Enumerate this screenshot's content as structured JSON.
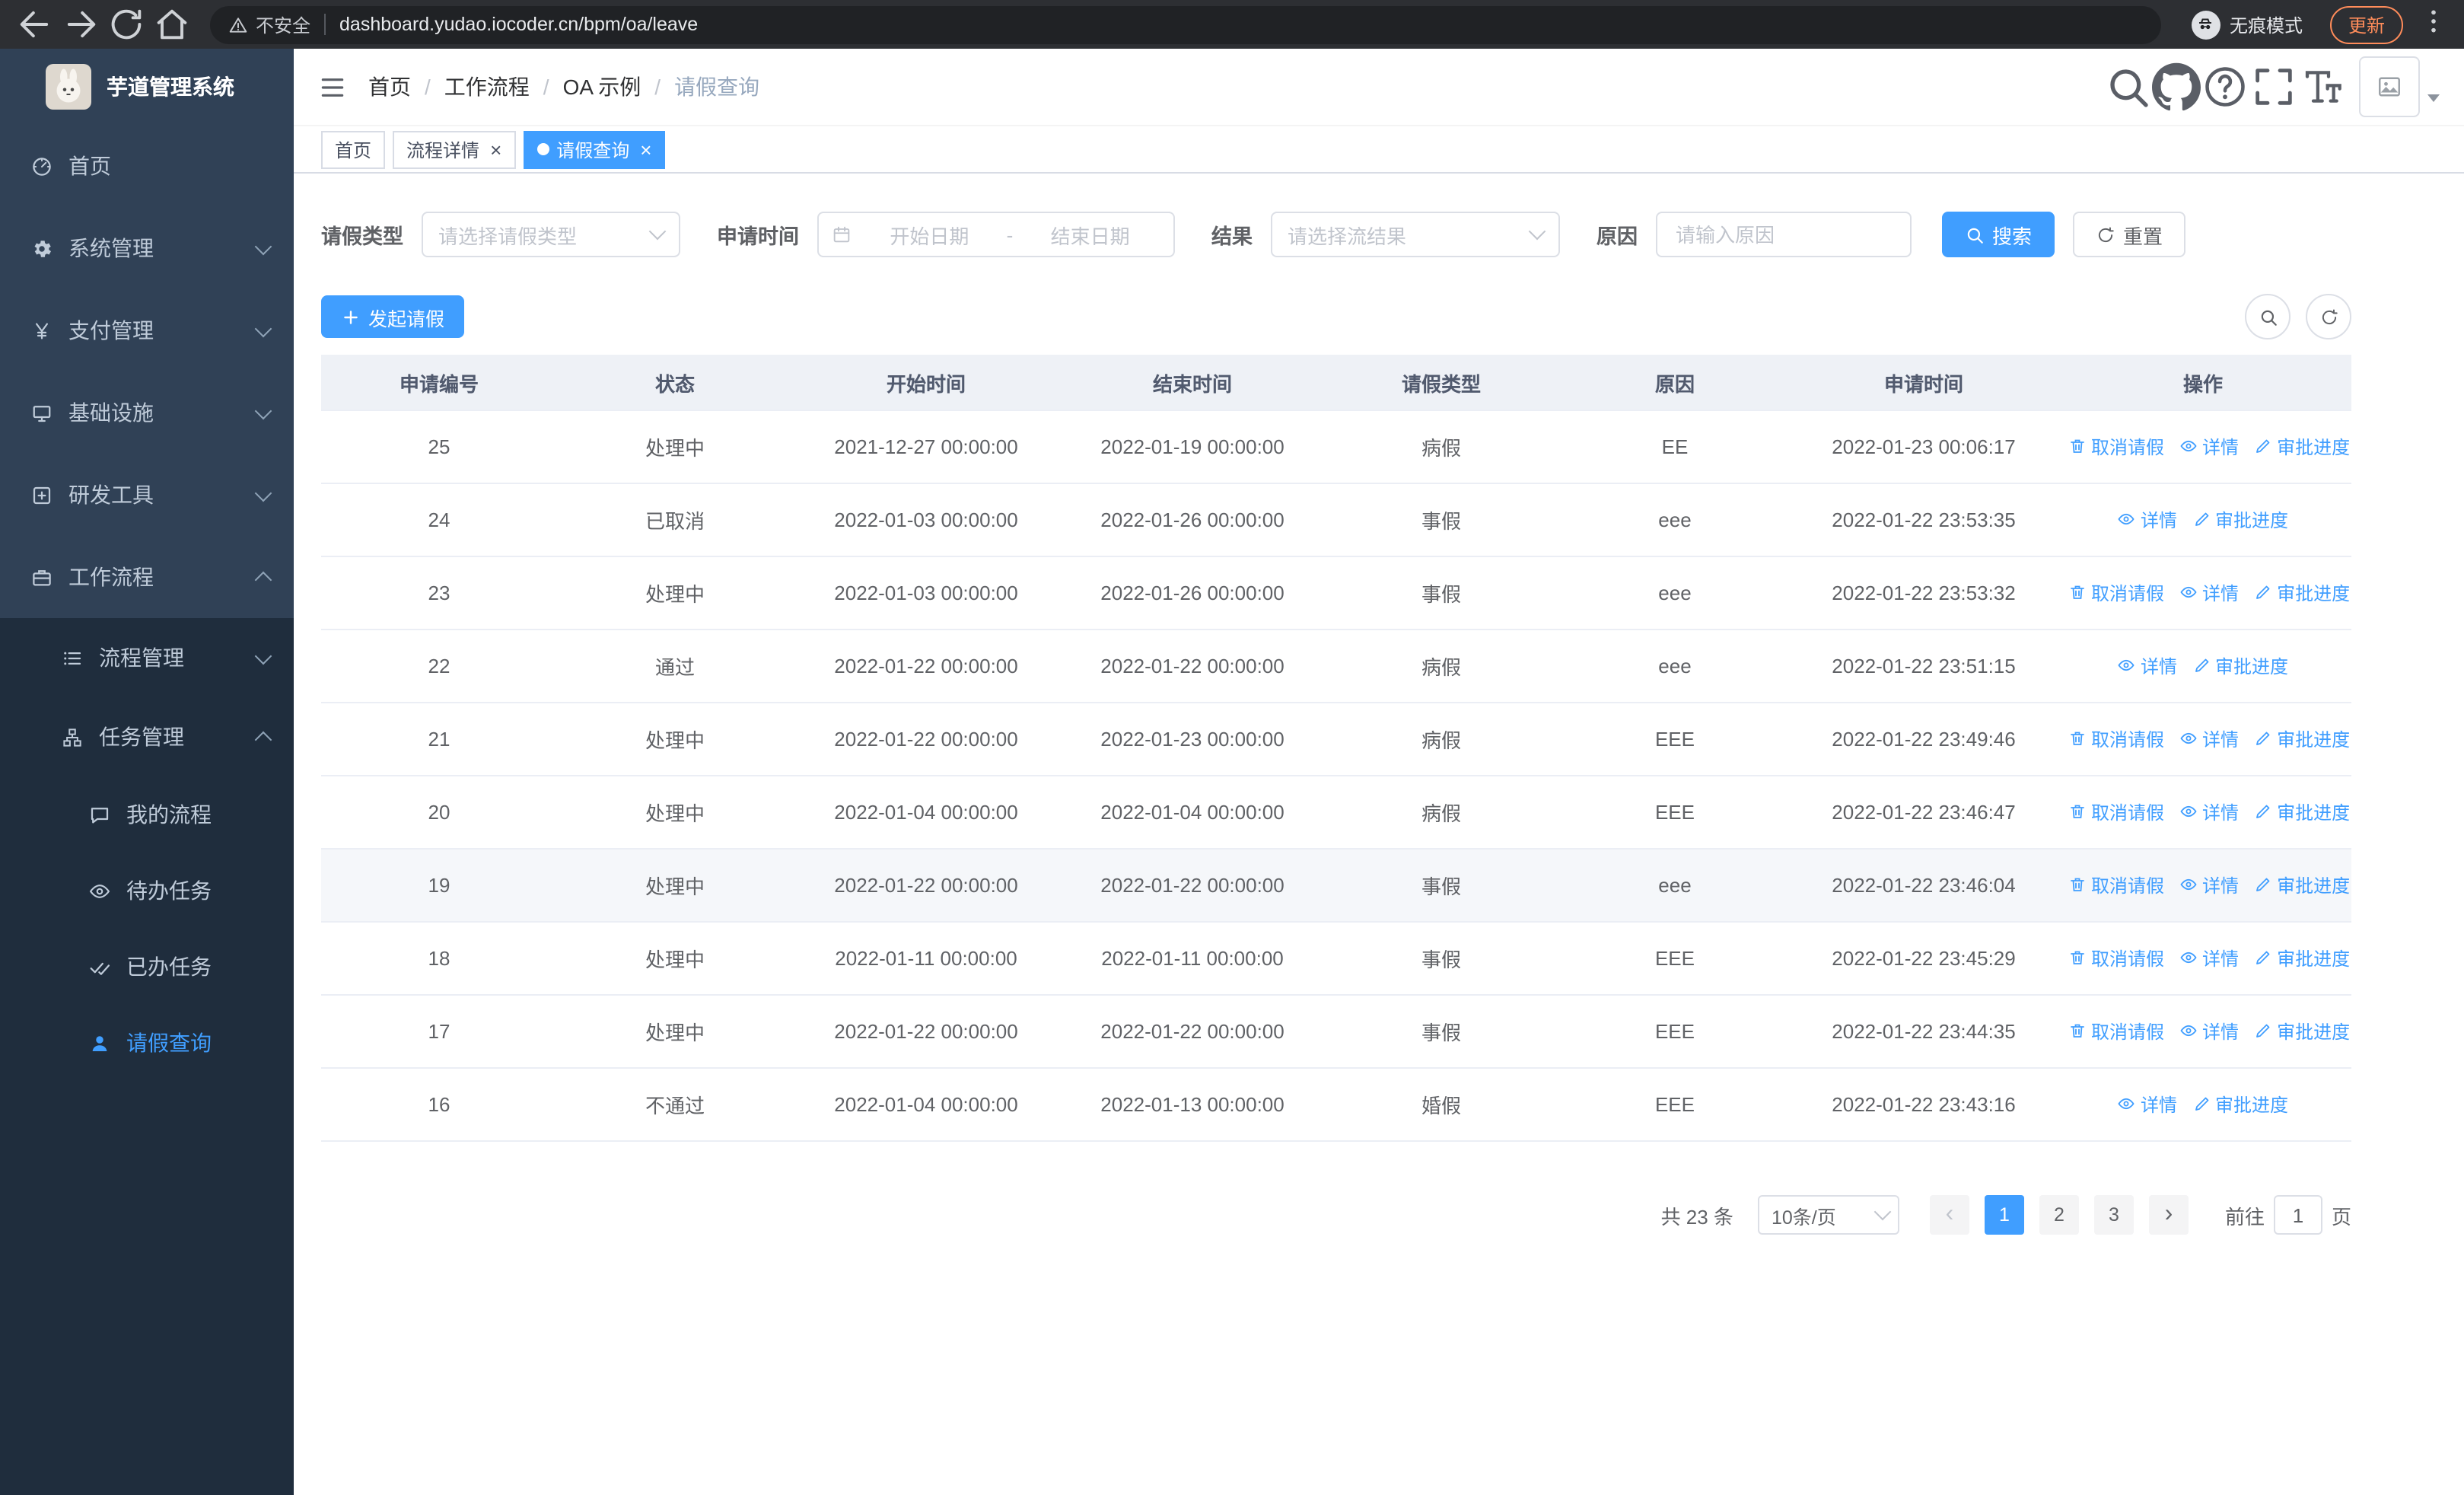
{
  "browser": {
    "security_warning": "不安全",
    "url": "dashboard.yudao.iocoder.cn/bpm/oa/leave",
    "incognito_label": "无痕模式",
    "update_label": "更新"
  },
  "sidebar": {
    "logo_title": "芋道管理系统",
    "menu": [
      {
        "label": "首页",
        "icon": "dashboard-icon",
        "level": 1,
        "arrow": null,
        "dark": false,
        "active": false
      },
      {
        "label": "系统管理",
        "icon": "gear-icon",
        "level": 1,
        "arrow": "down",
        "dark": false,
        "active": false
      },
      {
        "label": "支付管理",
        "icon": "payment-icon",
        "level": 1,
        "arrow": "down",
        "dark": false,
        "active": false
      },
      {
        "label": "基础设施",
        "icon": "infra-icon",
        "level": 1,
        "arrow": "down",
        "dark": false,
        "active": false
      },
      {
        "label": "研发工具",
        "icon": "tools-icon",
        "level": 1,
        "arrow": "down",
        "dark": false,
        "active": false
      },
      {
        "label": "工作流程",
        "icon": "workflow-icon",
        "level": 1,
        "arrow": "up",
        "dark": false,
        "active": false
      },
      {
        "label": "流程管理",
        "icon": "process-icon",
        "level": 2,
        "arrow": "down",
        "dark": true,
        "active": false
      },
      {
        "label": "任务管理",
        "icon": "task-icon",
        "level": 2,
        "arrow": "up",
        "dark": true,
        "active": false
      },
      {
        "label": "我的流程",
        "icon": "my-process-icon",
        "level": 3,
        "arrow": null,
        "dark": true,
        "active": false
      },
      {
        "label": "待办任务",
        "icon": "todo-icon",
        "level": 3,
        "arrow": null,
        "dark": true,
        "active": false
      },
      {
        "label": "已办任务",
        "icon": "done-icon",
        "level": 3,
        "arrow": null,
        "dark": true,
        "active": false
      },
      {
        "label": "请假查询",
        "icon": "leave-icon",
        "level": 3,
        "arrow": null,
        "dark": true,
        "active": true
      }
    ]
  },
  "navbar": {
    "breadcrumb": [
      {
        "label": "首页",
        "current": false
      },
      {
        "label": "工作流程",
        "current": false
      },
      {
        "label": "OA 示例",
        "current": false
      },
      {
        "label": "请假查询",
        "current": true
      }
    ]
  },
  "tabs": [
    {
      "label": "首页",
      "closable": false,
      "active": false
    },
    {
      "label": "流程详情",
      "closable": true,
      "active": false
    },
    {
      "label": "请假查询",
      "closable": true,
      "active": true
    }
  ],
  "filters": {
    "leave_type": {
      "label": "请假类型",
      "placeholder": "请选择请假类型"
    },
    "apply_time": {
      "label": "申请时间",
      "start_placeholder": "开始日期",
      "separator": "-",
      "end_placeholder": "结束日期"
    },
    "result": {
      "label": "结果",
      "placeholder": "请选择流结果"
    },
    "reason": {
      "label": "原因",
      "placeholder": "请输入原因"
    },
    "search_label": "搜索",
    "reset_label": "重置"
  },
  "toolbar": {
    "create_label": "发起请假"
  },
  "table": {
    "columns": [
      "申请编号",
      "状态",
      "开始时间",
      "结束时间",
      "请假类型",
      "原因",
      "申请时间",
      "操作"
    ],
    "action_labels": {
      "cancel": "取消请假",
      "detail": "详情",
      "progress": "审批进度"
    },
    "rows": [
      {
        "id": "25",
        "status": "处理中",
        "start": "2021-12-27 00:00:00",
        "end": "2022-01-19 00:00:00",
        "type": "病假",
        "reason": "EE",
        "applied": "2022-01-23 00:06:17",
        "actions": [
          "cancel",
          "detail",
          "progress"
        ],
        "highlighted": false
      },
      {
        "id": "24",
        "status": "已取消",
        "start": "2022-01-03 00:00:00",
        "end": "2022-01-26 00:00:00",
        "type": "事假",
        "reason": "eee",
        "applied": "2022-01-22 23:53:35",
        "actions": [
          "detail",
          "progress"
        ],
        "highlighted": false
      },
      {
        "id": "23",
        "status": "处理中",
        "start": "2022-01-03 00:00:00",
        "end": "2022-01-26 00:00:00",
        "type": "事假",
        "reason": "eee",
        "applied": "2022-01-22 23:53:32",
        "actions": [
          "cancel",
          "detail",
          "progress"
        ],
        "highlighted": false
      },
      {
        "id": "22",
        "status": "通过",
        "start": "2022-01-22 00:00:00",
        "end": "2022-01-22 00:00:00",
        "type": "病假",
        "reason": "eee",
        "applied": "2022-01-22 23:51:15",
        "actions": [
          "detail",
          "progress"
        ],
        "highlighted": false
      },
      {
        "id": "21",
        "status": "处理中",
        "start": "2022-01-22 00:00:00",
        "end": "2022-01-23 00:00:00",
        "type": "病假",
        "reason": "EEE",
        "applied": "2022-01-22 23:49:46",
        "actions": [
          "cancel",
          "detail",
          "progress"
        ],
        "highlighted": false
      },
      {
        "id": "20",
        "status": "处理中",
        "start": "2022-01-04 00:00:00",
        "end": "2022-01-04 00:00:00",
        "type": "病假",
        "reason": "EEE",
        "applied": "2022-01-22 23:46:47",
        "actions": [
          "cancel",
          "detail",
          "progress"
        ],
        "highlighted": false
      },
      {
        "id": "19",
        "status": "处理中",
        "start": "2022-01-22 00:00:00",
        "end": "2022-01-22 00:00:00",
        "type": "事假",
        "reason": "eee",
        "applied": "2022-01-22 23:46:04",
        "actions": [
          "cancel",
          "detail",
          "progress"
        ],
        "highlighted": true
      },
      {
        "id": "18",
        "status": "处理中",
        "start": "2022-01-11 00:00:00",
        "end": "2022-01-11 00:00:00",
        "type": "事假",
        "reason": "EEE",
        "applied": "2022-01-22 23:45:29",
        "actions": [
          "cancel",
          "detail",
          "progress"
        ],
        "highlighted": false
      },
      {
        "id": "17",
        "status": "处理中",
        "start": "2022-01-22 00:00:00",
        "end": "2022-01-22 00:00:00",
        "type": "事假",
        "reason": "EEE",
        "applied": "2022-01-22 23:44:35",
        "actions": [
          "cancel",
          "detail",
          "progress"
        ],
        "highlighted": false
      },
      {
        "id": "16",
        "status": "不通过",
        "start": "2022-01-04 00:00:00",
        "end": "2022-01-13 00:00:00",
        "type": "婚假",
        "reason": "EEE",
        "applied": "2022-01-22 23:43:16",
        "actions": [
          "detail",
          "progress"
        ],
        "highlighted": false
      }
    ]
  },
  "pagination": {
    "total_text": "共 23 条",
    "page_size": "10条/页",
    "pages": [
      "1",
      "2",
      "3"
    ],
    "active_page": "1",
    "goto_label": "前往",
    "goto_value": "1",
    "goto_suffix": "页"
  },
  "colors": {
    "primary": "#409eff",
    "sidebar_bg": "#304156",
    "submenu_bg": "#1f2d3d",
    "update_badge": "#ff8c5a"
  }
}
